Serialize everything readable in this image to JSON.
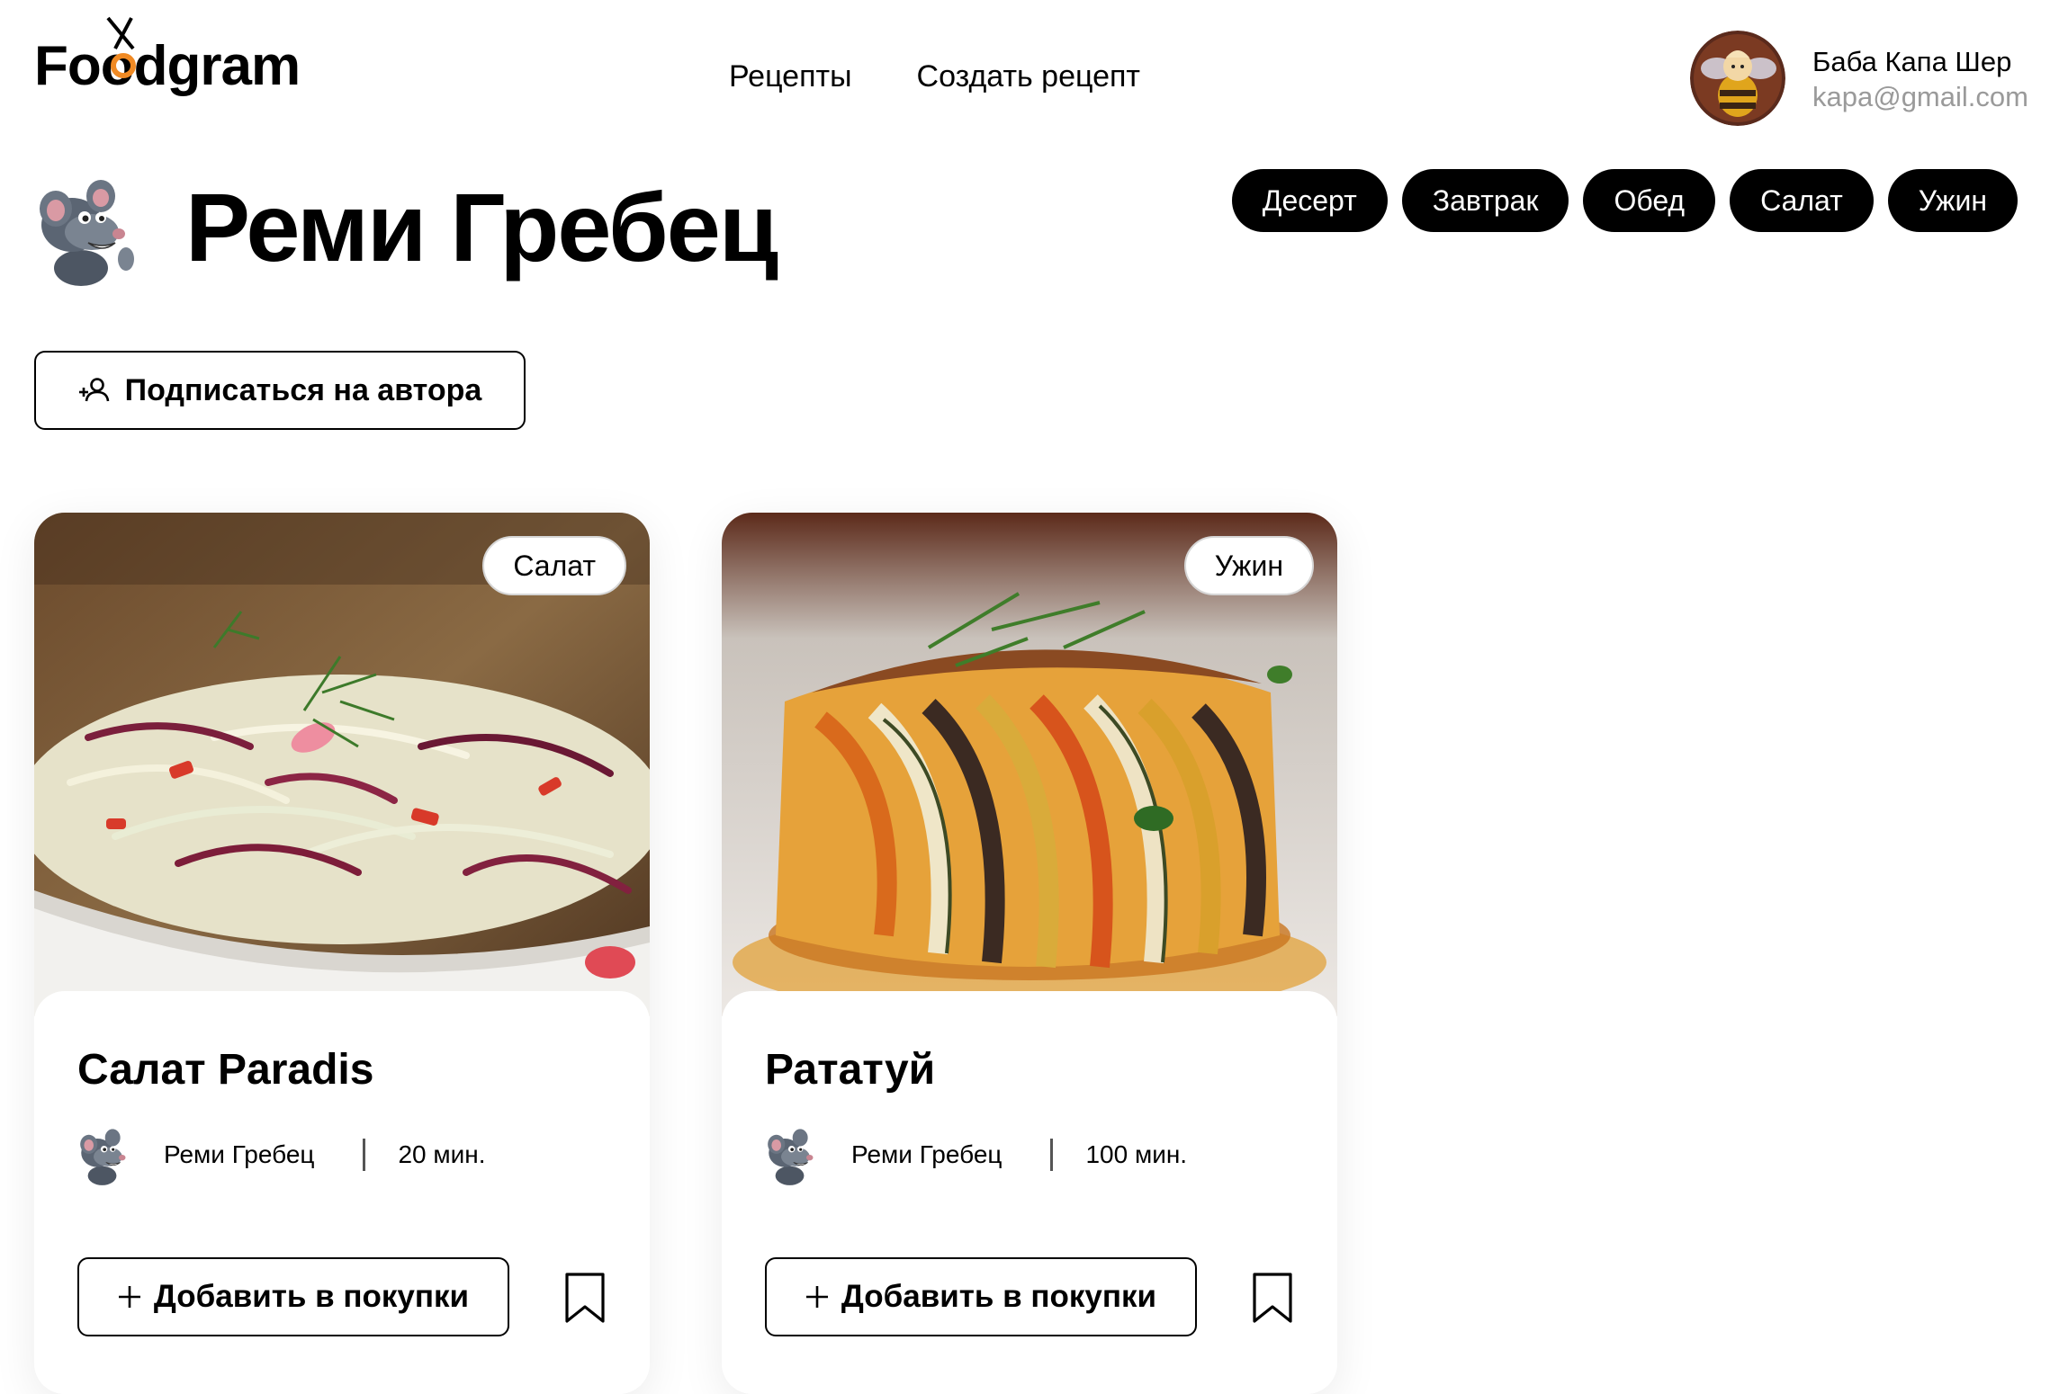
{
  "header": {
    "logo_text": "Foodgram",
    "nav": [
      {
        "label": "Рецепты"
      },
      {
        "label": "Создать рецепт"
      }
    ],
    "user": {
      "name": "Баба Капа Шер",
      "email": "kapa@gmail.com"
    }
  },
  "author": {
    "name": "Реми Гребец",
    "subscribe_label": "Подписаться на автора"
  },
  "tags": [
    {
      "label": "Десерт"
    },
    {
      "label": "Завтрак"
    },
    {
      "label": "Обед"
    },
    {
      "label": "Салат"
    },
    {
      "label": "Ужин"
    }
  ],
  "recipes": [
    {
      "title": "Салат Paradis",
      "tag": "Салат",
      "author": "Реми Гребец",
      "time": "20 мин.",
      "add_label": "Добавить в покупки"
    },
    {
      "title": "Рататуй",
      "tag": "Ужин",
      "author": "Реми Гребец",
      "time": "100 мин.",
      "add_label": "Добавить в покупки"
    }
  ],
  "colors": {
    "accent_orange": "#f08a24",
    "text": "#000000",
    "muted": "#9a9a9a"
  },
  "icons": [
    "foodgram-logo",
    "user-avatar",
    "rat-avatar-icon",
    "add-user-icon",
    "plus-icon",
    "bookmark-icon"
  ]
}
